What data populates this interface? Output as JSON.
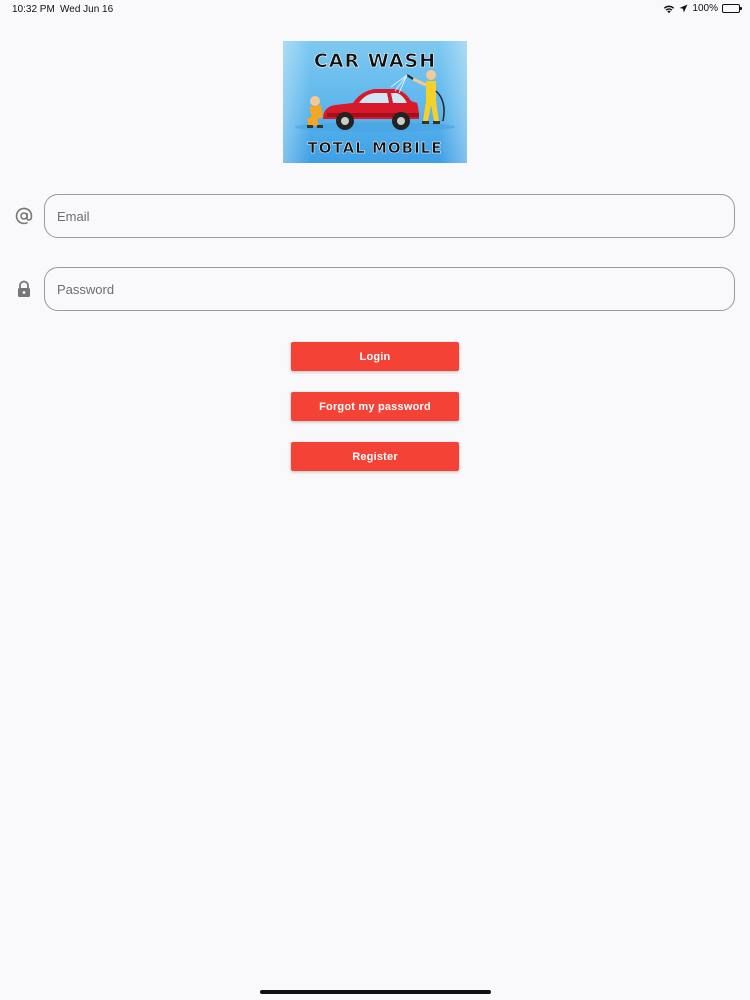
{
  "status_bar": {
    "time": "10:32 PM",
    "date": "Wed Jun 16",
    "battery_text": "100%",
    "icons": [
      "wifi-icon",
      "location-arrow-icon",
      "battery-icon"
    ]
  },
  "logo": {
    "line1": "CAR WASH",
    "line2": "TOTAL MOBILE"
  },
  "form": {
    "email": {
      "icon": "at-sign-icon",
      "placeholder": "Email",
      "value": ""
    },
    "password": {
      "icon": "lock-icon",
      "placeholder": "Password",
      "value": ""
    }
  },
  "buttons": {
    "login": "Login",
    "forgot": "Forgot my password",
    "register": "Register"
  },
  "colors": {
    "accent": "#f44336",
    "background": "#f9f9fb",
    "border": "#9a9a9a"
  }
}
